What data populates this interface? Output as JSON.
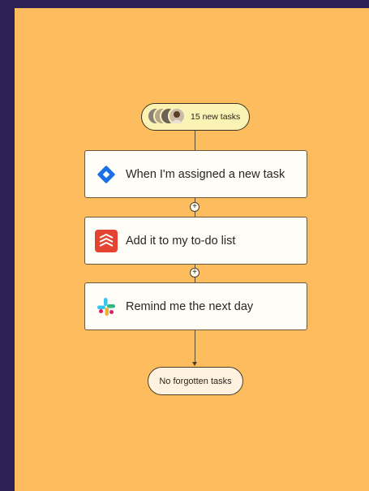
{
  "trigger_pill": {
    "label": "15 new tasks"
  },
  "steps": [
    {
      "label": "When I'm assigned a new task",
      "icon": "jira-icon"
    },
    {
      "label": "Add it to my to-do list",
      "icon": "todoist-icon"
    },
    {
      "label": "Remind me the next day",
      "icon": "slack-icon"
    }
  ],
  "add_step_symbol": "+",
  "result_pill": {
    "label": "No forgotten tasks"
  },
  "colors": {
    "frame": "#2b2156",
    "background": "#fdbd5f",
    "trigger_pill": "#fbf3b3",
    "card": "#fffdf8",
    "jira": "#1a6fe6",
    "todoist": "#e44332"
  }
}
